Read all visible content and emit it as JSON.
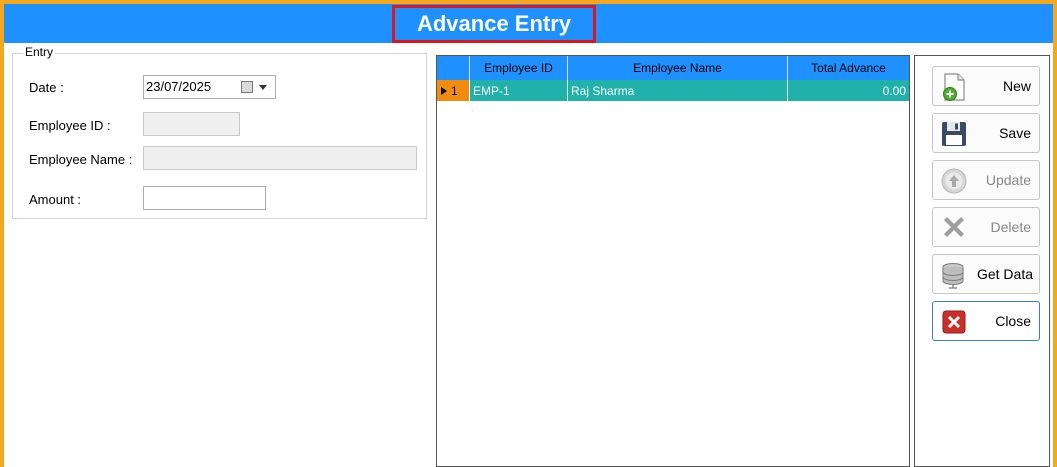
{
  "title": "Advance Entry",
  "entry": {
    "legend": "Entry",
    "date_label": "Date :",
    "date_value": "23/07/2025",
    "employee_id_label": "Employee ID :",
    "employee_id_value": "",
    "employee_name_label": "Employee Name :",
    "employee_name_value": "",
    "amount_label": "Amount :",
    "amount_value": ""
  },
  "grid": {
    "columns": [
      "Employee ID",
      "Employee Name",
      "Total Advance"
    ],
    "rows": [
      {
        "index": "1",
        "employee_id": "EMP-1",
        "employee_name": "Raj Sharma",
        "total_advance": "0.00"
      }
    ]
  },
  "buttons": {
    "new": "New",
    "save": "Save",
    "update": "Update",
    "delete": "Delete",
    "get_data": "Get Data",
    "close": "Close"
  },
  "icons": {
    "new": "new-document-icon",
    "save": "floppy-disk-icon",
    "update": "up-arrow-circle-icon",
    "delete": "x-cross-icon",
    "get_data": "database-icon",
    "close": "red-close-icon"
  },
  "colors": {
    "frame": "#f4a81c",
    "title_bar": "#1e90ff",
    "title_highlight": "#d8171f",
    "grid_header": "#1e90ff",
    "selected_row": "#20b2aa",
    "row_header": "#f28c0f"
  }
}
